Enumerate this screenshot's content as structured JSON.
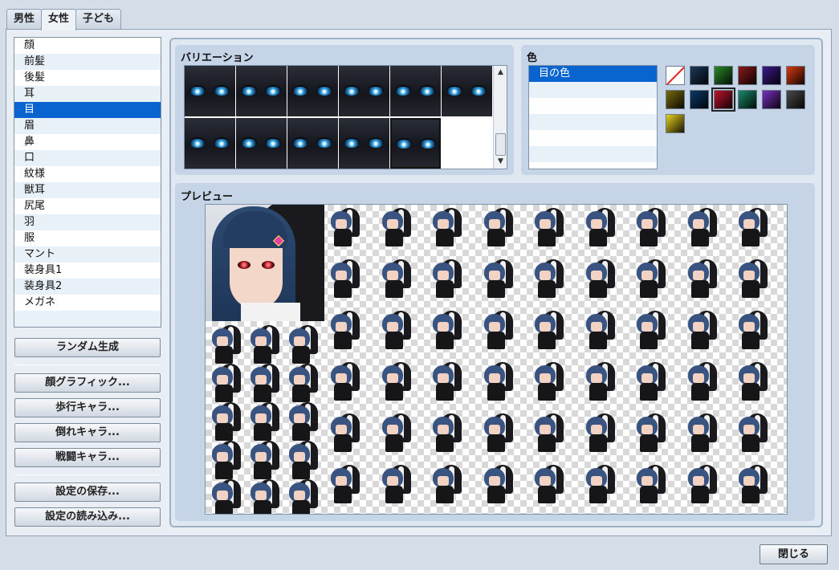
{
  "tabs": [
    "男性",
    "女性",
    "子ども"
  ],
  "parts": [
    "顔",
    "前髪",
    "後髪",
    "耳",
    "目",
    "眉",
    "鼻",
    "口",
    "紋様",
    "獣耳",
    "尻尾",
    "羽",
    "服",
    "マント",
    "装身具1",
    "装身具2",
    "メガネ"
  ],
  "selected_part_index": 4,
  "buttons": {
    "random": "ランダム生成",
    "face_graphic": "顔グラフィック...",
    "walk_char": "歩行キャラ...",
    "down_char": "倒れキャラ...",
    "battle_char": "戦闘キャラ...",
    "save_settings": "設定の保存...",
    "load_settings": "設定の読み込み...",
    "close": "閉じる"
  },
  "variation": {
    "title": "バリエーション",
    "selected_index": 10
  },
  "color": {
    "title": "色",
    "rows": [
      "目の色",
      "",
      "",
      "",
      "",
      ""
    ],
    "swatches": [
      "none",
      "#1c3a5a",
      "#2a8a2a",
      "#8a1a1a",
      "#3a1a8a",
      "#d83a10",
      "#7a6a10",
      "#0a3a6a",
      "#c01530",
      "#1a8a6a",
      "#7a30c0",
      "#4a4a4a",
      "#e8d020"
    ],
    "selected_swatch": 8
  },
  "preview": {
    "title": "プレビュー"
  }
}
